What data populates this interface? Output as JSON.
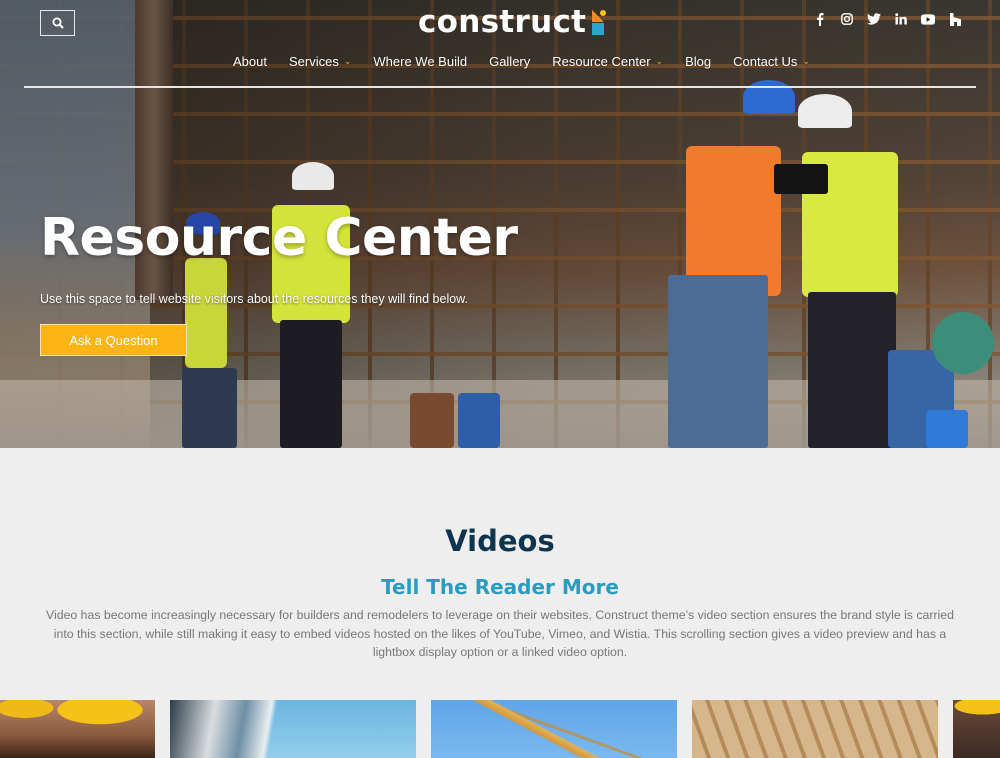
{
  "header": {
    "logo_text": "construct",
    "search_icon": "search-icon",
    "social": [
      {
        "name": "facebook",
        "icon": "facebook-icon",
        "glyph": "f"
      },
      {
        "name": "instagram",
        "icon": "instagram-icon",
        "glyph": "◎"
      },
      {
        "name": "twitter",
        "icon": "twitter-icon",
        "glyph": "🐦"
      },
      {
        "name": "linkedin",
        "icon": "linkedin-icon",
        "glyph": "in"
      },
      {
        "name": "youtube",
        "icon": "youtube-icon",
        "glyph": "▶"
      },
      {
        "name": "houzz",
        "icon": "houzz-icon",
        "glyph": "h"
      }
    ],
    "nav": [
      {
        "label": "About",
        "dropdown": false
      },
      {
        "label": "Services",
        "dropdown": true
      },
      {
        "label": "Where We Build",
        "dropdown": false
      },
      {
        "label": "Gallery",
        "dropdown": false
      },
      {
        "label": "Resource Center",
        "dropdown": true
      },
      {
        "label": "Blog",
        "dropdown": false
      },
      {
        "label": "Contact Us",
        "dropdown": true
      }
    ]
  },
  "hero": {
    "title": "Resource Center",
    "subtitle": "Use this space to tell website visitors about the resources they will find below.",
    "cta_label": "Ask a Question"
  },
  "videos": {
    "title": "Videos",
    "subtitle": "Tell The Reader More",
    "description": "Video has become increasingly necessary for builders and remodelers to leverage on their websites. Construct theme’s video section ensures the brand style is carried into this section, while still making it easy to embed videos hosted on the likes of YouTube, Vimeo, and Wistia. This scrolling section gives a video preview and has a lightbox display option or a linked video option.",
    "cards": [
      {
        "subject": "workers-hard-hats"
      },
      {
        "subject": "modern-building"
      },
      {
        "subject": "crane"
      },
      {
        "subject": "wood-framing"
      },
      {
        "subject": "worker-hard-hat"
      }
    ]
  },
  "colors": {
    "accent_yellow": "#fdb515",
    "heading_navy": "#0e3550",
    "subheading_teal": "#2a9cc0",
    "logo_orange": "#f08a24",
    "logo_blue": "#2aa7cf"
  }
}
